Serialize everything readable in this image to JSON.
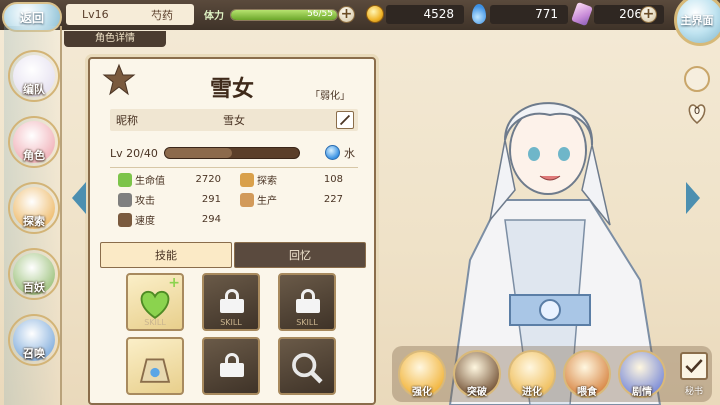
{
  "topbar": {
    "back_label": "返回",
    "level": "Lv16",
    "player_name": "芍药",
    "stamina_label": "体力",
    "stamina_value": "56/55",
    "stamina_fraction": 1.0,
    "coins": "4528",
    "water": "771",
    "crystals": "206",
    "main_label": "主界面"
  },
  "subtab": "角色详情",
  "nav": [
    {
      "label": "编队",
      "name": "nav-formation",
      "color": "#e8e4f2"
    },
    {
      "label": "角色",
      "name": "nav-character",
      "color": "#f2b9c0"
    },
    {
      "label": "探索",
      "name": "nav-explore",
      "color": "#f0c27a"
    },
    {
      "label": "百妖",
      "name": "nav-yokai",
      "color": "#a7c88a"
    },
    {
      "label": "召唤",
      "name": "nav-summon",
      "color": "#8fb6e0"
    }
  ],
  "character": {
    "name": "雪女",
    "trait": "「弱化」",
    "nickname_key": "昵称",
    "nickname": "雪女",
    "level": "Lv 20/40",
    "level_fraction": 0.5,
    "element": "水",
    "stats": [
      {
        "name": "生命值",
        "value": "2720",
        "icon": "heart-icon",
        "color": "#7dc44a"
      },
      {
        "name": "探索",
        "value": "108",
        "icon": "explore-icon",
        "color": "#d9a04a"
      },
      {
        "name": "攻击",
        "value": "291",
        "icon": "sword-icon",
        "color": "#7f7f7f"
      },
      {
        "name": "生产",
        "value": "227",
        "icon": "production-icon",
        "color": "#d29a5a"
      },
      {
        "name": "速度",
        "value": "294",
        "icon": "boot-icon",
        "color": "#7a5a3e"
      }
    ]
  },
  "skill_tabs": {
    "skills": "技能",
    "memory": "回忆"
  },
  "skill_slot_label": "SKILL",
  "actions": [
    {
      "label": "强化",
      "name": "enhance-button",
      "color": "#f2b640"
    },
    {
      "label": "突破",
      "name": "breakthrough-button",
      "color": "#7a5a3e"
    },
    {
      "label": "进化",
      "name": "evolve-button",
      "color": "#f0c060"
    },
    {
      "label": "喂食",
      "name": "feed-button",
      "color": "#d98a4a"
    },
    {
      "label": "剧情",
      "name": "story-button",
      "color": "#7f8fd8"
    }
  ],
  "heart_count": "0",
  "check_label": "秘书",
  "colors": {
    "accent": "#8a6d4b",
    "stamina": "#8bc34a",
    "dark_bar": "#3f3329"
  }
}
